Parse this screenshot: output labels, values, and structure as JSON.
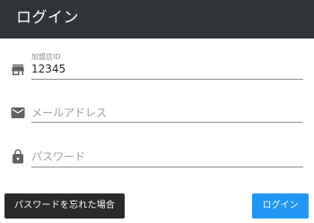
{
  "header": {
    "title": "ログイン",
    "background": "#303436"
  },
  "form": {
    "store_id": {
      "label": "加盟店ID",
      "value": "12345",
      "icon": "store-icon"
    },
    "email": {
      "placeholder": "メールアドレス",
      "value": "",
      "icon": "mail-icon"
    },
    "password": {
      "placeholder": "パスワード",
      "value": "",
      "icon": "lock-icon"
    }
  },
  "actions": {
    "forgot_password_label": "パスワードを忘れた場合",
    "login_label": "ログイン",
    "login_color": "#2196f3",
    "forgot_color": "#2a2a2a"
  }
}
